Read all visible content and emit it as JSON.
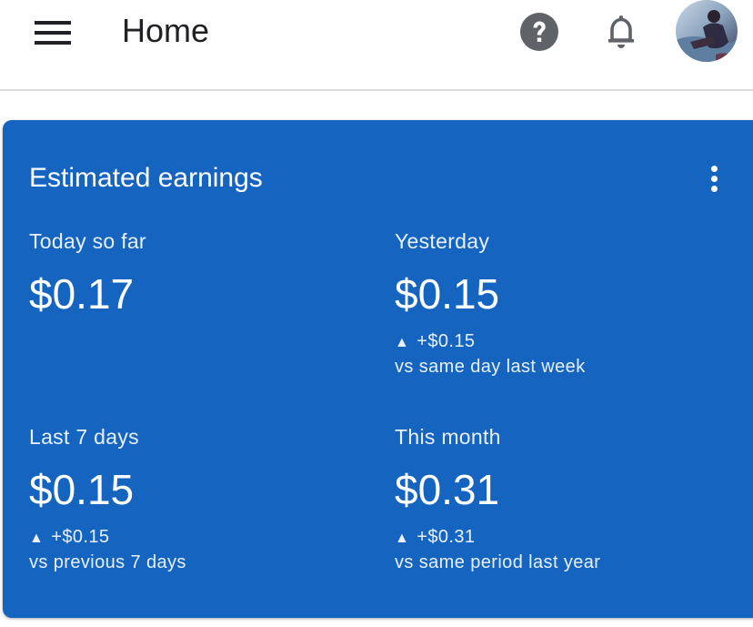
{
  "header": {
    "title": "Home",
    "menu_icon": "hamburger-menu-icon",
    "help_icon": "help-icon",
    "notifications_icon": "bell-icon"
  },
  "card": {
    "title": "Estimated earnings",
    "background_color": "#1565c0",
    "metrics": [
      {
        "label": "Today so far",
        "value": "$0.17"
      },
      {
        "label": "Yesterday",
        "value": "$0.15",
        "change": "+$0.15",
        "compare": "vs same day last week"
      },
      {
        "label": "Last 7 days",
        "value": "$0.15",
        "change": "+$0.15",
        "compare": "vs previous 7 days"
      },
      {
        "label": "This month",
        "value": "$0.31",
        "change": "+$0.31",
        "compare": "vs same period last year"
      }
    ]
  }
}
